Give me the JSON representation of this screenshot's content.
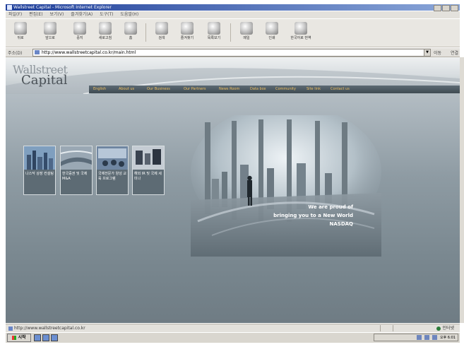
{
  "window": {
    "title": "Wallstreet Capital - Microsoft Internet Explorer"
  },
  "menu": [
    "파일(F)",
    "편집(E)",
    "보기(V)",
    "즐겨찾기(A)",
    "도구(T)",
    "도움말(H)"
  ],
  "toolbar": [
    {
      "label": "뒤로",
      "icon": "back-arrow-icon"
    },
    {
      "label": "앞으로",
      "icon": "forward-arrow-icon"
    },
    {
      "label": "중지",
      "icon": "stop-icon"
    },
    {
      "label": "새로고침",
      "icon": "refresh-icon"
    },
    {
      "label": "홈",
      "icon": "home-icon"
    },
    {
      "label": "검색",
      "icon": "search-icon"
    },
    {
      "label": "즐겨찾기",
      "icon": "favorites-icon"
    },
    {
      "label": "목록보기",
      "icon": "history-icon"
    },
    {
      "label": "메일",
      "icon": "mail-icon"
    },
    {
      "label": "인쇄",
      "icon": "print-icon"
    },
    {
      "label": "한국어로 번역",
      "icon": "translate-icon"
    }
  ],
  "address": {
    "label": "주소(D)",
    "url": "http://www.wallstreetcapital.co.kr/main.html",
    "go": "이동",
    "links": "연결"
  },
  "site": {
    "logo_top": "Wallstreet",
    "logo_bottom": "Capital",
    "nav": [
      "English",
      "About us",
      "Our Business",
      "Our Partners",
      "News Room",
      "Data box",
      "Community",
      "Site link",
      "Contact us"
    ],
    "thumbs": [
      {
        "caption": "나스닥 상장 컨설팅"
      },
      {
        "caption": "한국증권 및 국제 M&A"
      },
      {
        "caption": "국제전문가 양성 교육 프로그램"
      },
      {
        "caption": "해외 IR 및 국제 세미나"
      }
    ],
    "slogan": [
      "We are proud of",
      "bringing you to a New World",
      "NASDAQ"
    ]
  },
  "status": {
    "url": "http://www.wallstreetcapital.co.kr",
    "zone": "인터넷"
  },
  "taskbar": {
    "start": "시작",
    "clock": "오후 6:01"
  }
}
